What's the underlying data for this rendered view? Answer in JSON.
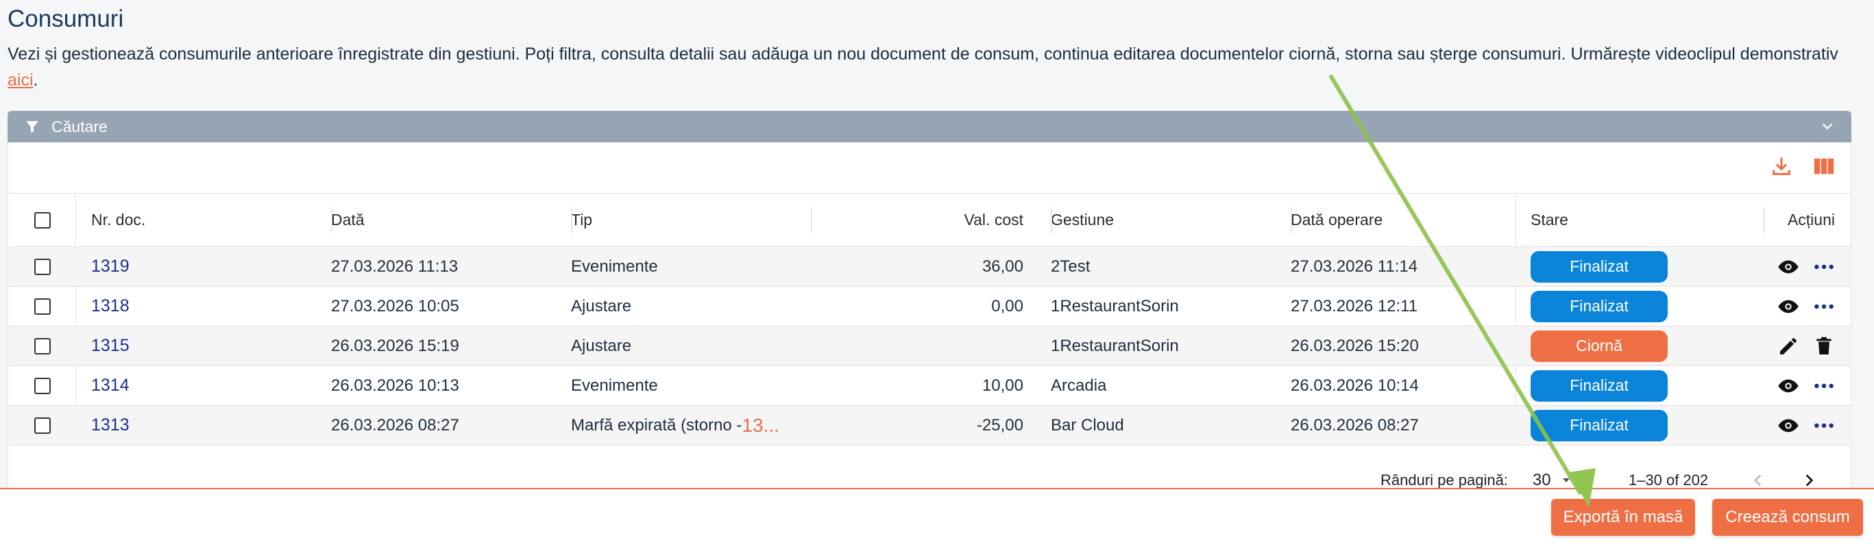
{
  "page": {
    "title": "Consumuri",
    "description_pre": "Vezi și gestionează consumurile anterioare înregistrate din gestiuni. Poți filtra, consulta detalii sau adăuga un nou document de consum, continua editarea documentelor ciornă, storna sau șterge consumuri. Urmărește videoclipul demonstrativ ",
    "description_link": "aici",
    "description_post": "."
  },
  "search": {
    "label": "Căutare"
  },
  "toolbar": {
    "icons": [
      "download-icon",
      "columns-icon"
    ]
  },
  "table": {
    "columns": {
      "nr": "Nr. doc.",
      "data": "Dată",
      "tip": "Tip",
      "val": "Val. cost",
      "gest": "Gestiune",
      "dop": "Dată operare",
      "stare": "Stare",
      "act": "Acțiuni"
    },
    "rows": [
      {
        "nr": "1319",
        "data": "27.03.2026 11:13",
        "tip": "Evenimente",
        "tip_num": "",
        "val": "36,00",
        "gest": "2Test",
        "dop": "27.03.2026 11:14",
        "stare": "Finalizat",
        "status": "done"
      },
      {
        "nr": "1318",
        "data": "27.03.2026 10:05",
        "tip": "Ajustare",
        "tip_num": "",
        "val": "0,00",
        "gest": "1RestaurantSorin",
        "dop": "27.03.2026 12:11",
        "stare": "Finalizat",
        "status": "done"
      },
      {
        "nr": "1315",
        "data": "26.03.2026 15:19",
        "tip": "Ajustare",
        "tip_num": "",
        "val": "",
        "gest": "1RestaurantSorin",
        "dop": "26.03.2026 15:20",
        "stare": "Ciornă",
        "status": "draft"
      },
      {
        "nr": "1314",
        "data": "26.03.2026 10:13",
        "tip": "Evenimente",
        "tip_num": "",
        "val": "10,00",
        "gest": "Arcadia",
        "dop": "26.03.2026 10:14",
        "stare": "Finalizat",
        "status": "done"
      },
      {
        "nr": "1313",
        "data": "26.03.2026 08:27",
        "tip": "Marfă expirată (storno - ",
        "tip_num": "13...",
        "val": "-25,00",
        "gest": "Bar Cloud",
        "dop": "26.03.2026 08:27",
        "stare": "Finalizat",
        "status": "done"
      }
    ]
  },
  "pagination": {
    "rows_label": "Rânduri pe pagină:",
    "rows_value": "30",
    "range": "1–30 of 202"
  },
  "actions": {
    "export": "Exportă în masă",
    "create": "Creează consum"
  },
  "colors": {
    "accent": "#ef6f45",
    "done": "#0a84d8",
    "header_bar": "#97a4b3",
    "link": "#1b2e8c"
  }
}
